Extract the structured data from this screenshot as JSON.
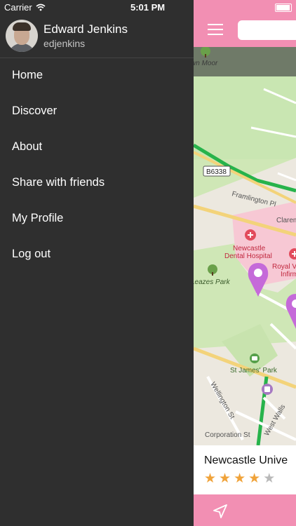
{
  "status_bar": {
    "carrier": "Carrier",
    "time": "5:01 PM"
  },
  "profile": {
    "name": "Edward Jenkins",
    "username": "edjenkins"
  },
  "menu": [
    {
      "label": "Home"
    },
    {
      "label": "Discover"
    },
    {
      "label": "About"
    },
    {
      "label": "Share with friends"
    },
    {
      "label": "My Profile"
    },
    {
      "label": "Log out"
    }
  ],
  "map": {
    "road_badge": "B6338",
    "labels": {
      "moor": "wn Moor",
      "framlington": "Framlington Pl",
      "claremont": "Claremo",
      "dental_line1": "Newcastle",
      "dental_line2": "Dental Hospital",
      "royal_line1": "Royal V",
      "royal_line2": "Infirm",
      "leazes": "Leazes Park",
      "st_james": "St James' Park",
      "wellington": "Wellington St",
      "corporation": "Corporation St",
      "west_walls": "West Walls"
    }
  },
  "place_card": {
    "title": "Newcastle Unive",
    "rating": 4,
    "max_rating": 5
  },
  "colors": {
    "accent": "#f28fb3",
    "drawer_bg": "#2f2f2f",
    "pin": "#c56ad9",
    "star_on": "#f0a33a",
    "star_off": "#b9b9b9"
  }
}
